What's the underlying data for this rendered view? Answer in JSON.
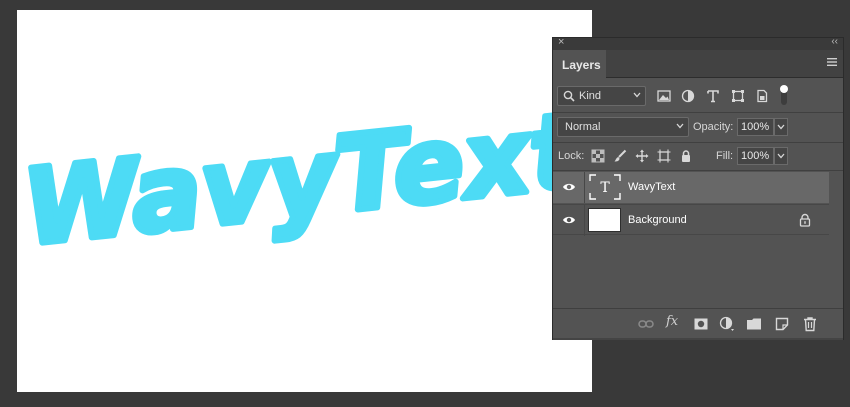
{
  "canvas": {
    "artwork_text": "WavyText",
    "artwork_color": "#4ddbf5",
    "background_color": "#ffffff"
  },
  "panel": {
    "close_icon": "close-icon",
    "collapse_icon": "double-chevron-icon",
    "tab_label": "Layers",
    "menu_icon": "hamburger-menu-icon",
    "filter": {
      "kind_label": "Kind",
      "icons": [
        "image-filter-icon",
        "adjustment-filter-icon",
        "type-filter-icon",
        "shape-filter-icon",
        "smart-object-filter-icon",
        "filter-toggle-icon"
      ]
    },
    "blend_mode": "Normal",
    "opacity_label": "Opacity:",
    "opacity_value": "100%",
    "lock_label": "Lock:",
    "lock_icons": [
      "lock-transparent-pixels-icon",
      "lock-image-pixels-icon",
      "lock-position-icon",
      "lock-artboard-icon",
      "lock-all-icon"
    ],
    "fill_label": "Fill:",
    "fill_value": "100%",
    "layers": [
      {
        "name": "WavyText",
        "type": "text",
        "thumbnail_glyph": "T",
        "visible": true,
        "selected": true,
        "locked": false
      },
      {
        "name": "Background",
        "type": "image",
        "visible": true,
        "selected": false,
        "locked": true
      }
    ],
    "bottom_icons": [
      "link-layers-icon",
      "fx-icon",
      "add-mask-icon",
      "adjustment-layer-icon",
      "new-group-icon",
      "new-layer-icon",
      "delete-icon"
    ],
    "fx_label": "fx",
    "colors": {
      "panel_bg": "#535353",
      "selected_layer": "#686868",
      "workspace": "#393939"
    }
  }
}
